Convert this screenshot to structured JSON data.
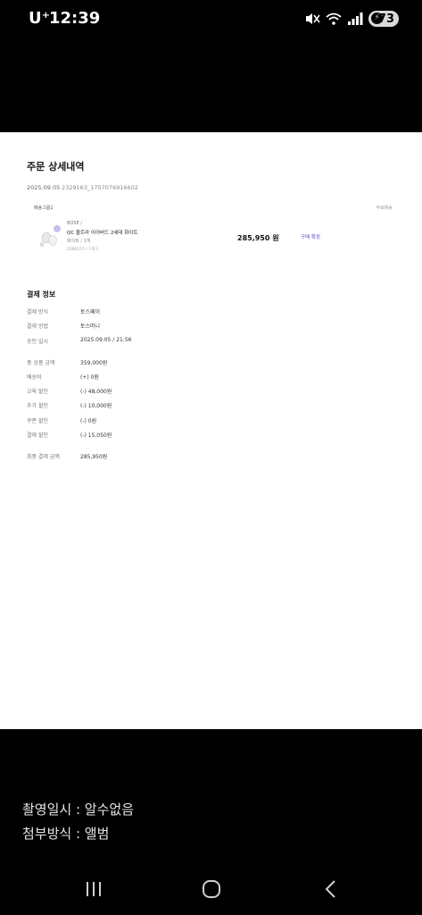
{
  "status_bar": {
    "carrier": "U⁺",
    "time": "12:39",
    "battery": "73"
  },
  "order": {
    "title": "주문 상세내역",
    "date": "2025.09.05",
    "order_number": "2329163_1757076916602",
    "shipping_group_label": "배송그룹1",
    "shipping_info": "무료배송",
    "product": {
      "brand": "BOSE /",
      "name": "QC 울트라 이어버드 2세대 화이트",
      "option": "화이트 / 1개",
      "extra": "2080157 / 1개구",
      "price": "285,950 원",
      "action": "구매 확정"
    }
  },
  "payment": {
    "title": "결제 정보",
    "rows": [
      {
        "label": "결제 방식",
        "value": "토스페이"
      },
      {
        "label": "결제 방법",
        "value": "토스머니"
      },
      {
        "label": "승인 일시",
        "value": "2025.09.05 / 21:56"
      },
      {
        "label": "총 상품 금액",
        "value": "359,000원"
      },
      {
        "label": "배송비",
        "value": "(+) 0원"
      },
      {
        "label": "교육 할인",
        "value": "(-) 48,000원"
      },
      {
        "label": "추가 할인",
        "value": "(-) 10,000원"
      },
      {
        "label": "쿠폰 할인",
        "value": "(-) 0원"
      },
      {
        "label": "결제 할인",
        "value": "(-) 15,050원"
      },
      {
        "label": "최종 결제 금액",
        "value": "285,950원"
      }
    ]
  },
  "caption": {
    "line1": "촬영일시 : 알수없음",
    "line2": "첨부방식 : 앨범"
  },
  "colors": {
    "accent": "#5a48c8",
    "background": "#000000",
    "page": "#ffffff"
  }
}
